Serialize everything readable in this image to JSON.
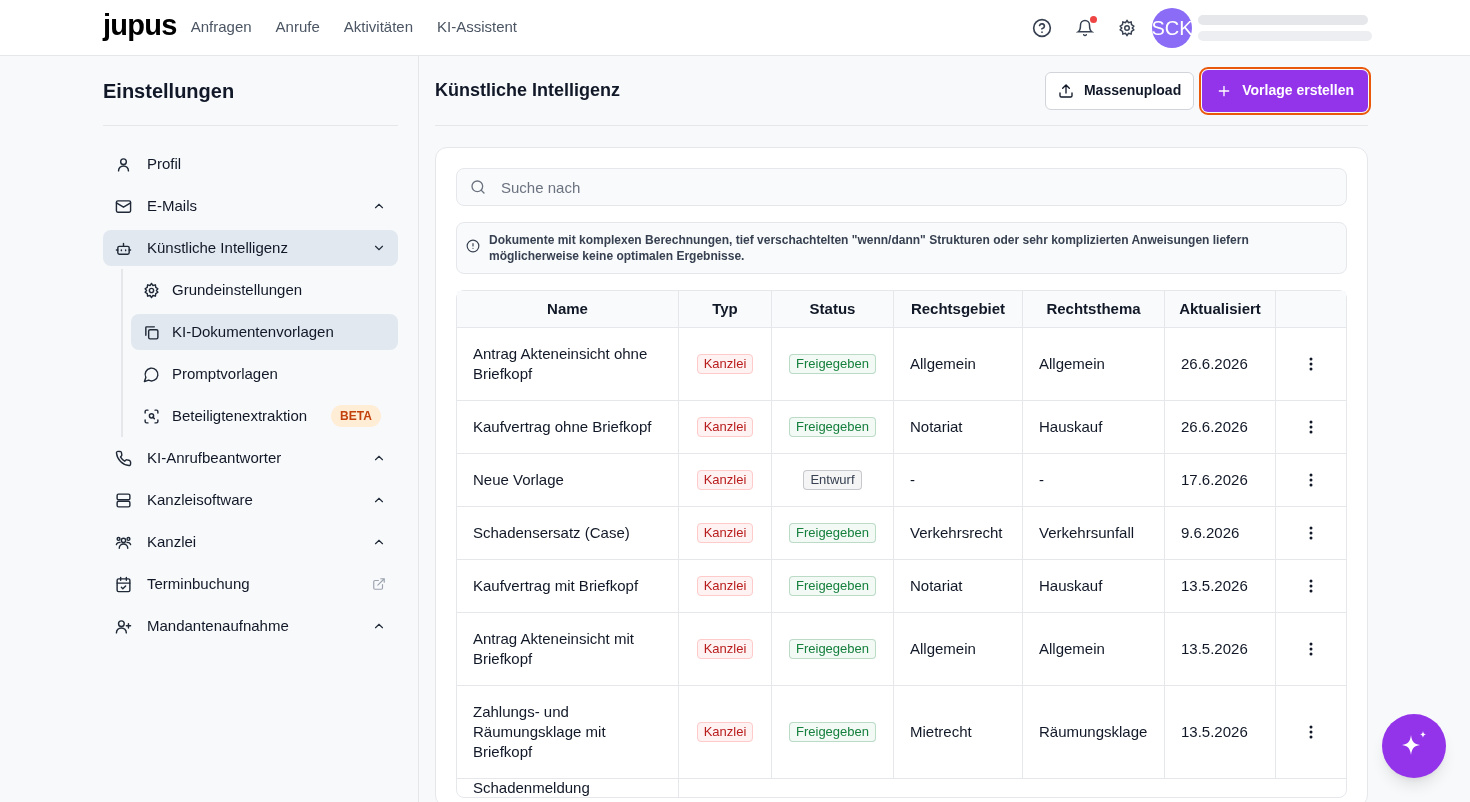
{
  "header": {
    "logo": "jupus",
    "nav": [
      {
        "label": "Anfragen",
        "selected": false
      },
      {
        "label": "Anrufe",
        "selected": false
      },
      {
        "label": "Aktivitäten",
        "selected": false
      },
      {
        "label": "KI-Assistent",
        "selected": false
      }
    ],
    "notification_dot": true,
    "avatar": "SCK"
  },
  "sidebar": {
    "title": "Einstellungen",
    "items": [
      {
        "label": "Profil",
        "selected": false
      },
      {
        "label": "E-Mails",
        "selected": false,
        "expanded": false
      },
      {
        "label": "Künstliche Intelligenz",
        "selected": true,
        "expanded": true,
        "children": [
          {
            "label": "Grundeinstellungen",
            "selected": false
          },
          {
            "label": "KI-Dokumentenvorlagen",
            "selected": true
          },
          {
            "label": "Promptvorlagen",
            "selected": false
          },
          {
            "label": "Beteiligtenextraktion",
            "selected": false,
            "badge": "BETA"
          }
        ]
      },
      {
        "label": "KI-Anrufbeantworter",
        "selected": false,
        "expanded": false
      },
      {
        "label": "Kanzleisoftware",
        "selected": false,
        "expanded": false
      },
      {
        "label": "Kanzlei",
        "selected": false,
        "expanded": false
      },
      {
        "label": "Terminbuchung",
        "selected": false,
        "external": true
      },
      {
        "label": "Mandantenaufnahme",
        "selected": false,
        "expanded": false
      }
    ]
  },
  "main": {
    "title": "Künstliche Intelligenz",
    "buttons": [
      {
        "label": "Massenupload",
        "kind": "secondary"
      },
      {
        "label": "Vorlage erstellen",
        "kind": "primary"
      }
    ],
    "search": {
      "placeholder": "Suche nach"
    },
    "notice": "Dokumente mit komplexen Berechnungen, tief verschachtelten \"wenn/dann\" Strukturen oder sehr komplizierten Anweisungen liefern möglicherweise keine optimalen Ergebnisse.",
    "table": {
      "columns": [
        "Name",
        "Typ",
        "Status",
        "Rechtsgebiet",
        "Rechtsthema",
        "Aktualisiert"
      ],
      "rows": [
        {
          "name": "Antrag Akteneinsicht ohne Briefkopf",
          "type": "Kanzlei",
          "status": {
            "label": "Freigegeben",
            "color": "#15803d"
          },
          "area": "Allgemein",
          "topic": "Allgemein",
          "updated": "26.6.2026"
        },
        {
          "name": "Kaufvertrag ohne Briefkopf",
          "type": "Kanzlei",
          "status": {
            "label": "Freigegeben",
            "color": "#15803d"
          },
          "area": "Notariat",
          "topic": "Hauskauf",
          "updated": "26.6.2026"
        },
        {
          "name": "Neue Vorlage",
          "type": "Kanzlei",
          "status": {
            "label": "Entwurf",
            "color": "#374151"
          },
          "area": "-",
          "topic": "-",
          "updated": "17.6.2026"
        },
        {
          "name": "Schadensersatz (Case)",
          "type": "Kanzlei",
          "status": {
            "label": "Freigegeben",
            "color": "#15803d"
          },
          "area": "Verkehrsrecht",
          "topic": "Verkehrsunfall",
          "updated": "9.6.2026"
        },
        {
          "name": "Kaufvertrag mit Briefkopf",
          "type": "Kanzlei",
          "status": {
            "label": "Freigegeben",
            "color": "#15803d"
          },
          "area": "Notariat",
          "topic": "Hauskauf",
          "updated": "13.5.2026"
        },
        {
          "name": "Antrag Akteneinsicht mit Briefkopf",
          "type": "Kanzlei",
          "status": {
            "label": "Freigegeben",
            "color": "#15803d"
          },
          "area": "Allgemein",
          "topic": "Allgemein",
          "updated": "13.5.2026"
        },
        {
          "name": "Zahlungs- und Räumungsklage mit Briefkopf",
          "type": "Kanzlei",
          "status": {
            "label": "Freigegeben",
            "color": "#15803d"
          },
          "area": "Mietrecht",
          "topic": "Räumungsklage",
          "updated": "13.5.2026"
        },
        {
          "name": "Schadenmeldung"
        }
      ]
    }
  }
}
